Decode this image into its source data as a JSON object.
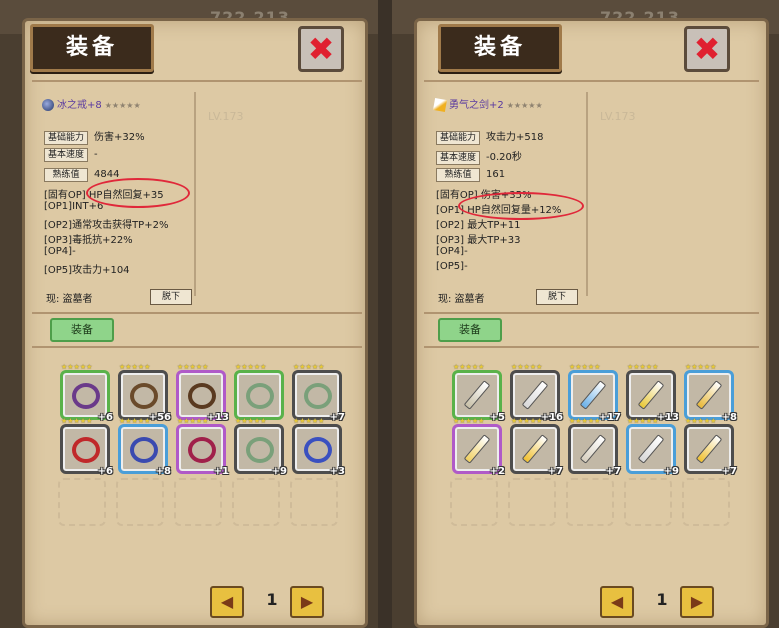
{
  "left": {
    "top_number": "722,213",
    "title": "装备",
    "item_name": "冰之戒+8",
    "stars": "★★★★★",
    "stats": [
      {
        "label": "基础能力",
        "value": "伤害+32%"
      },
      {
        "label": "基本速度",
        "value": "-"
      },
      {
        "label": "熟练值",
        "value": "4844"
      }
    ],
    "options": [
      {
        "prefix": "[固有OP]",
        "text": "HP自然回复+35"
      },
      {
        "prefix": "[OP1]",
        "text": "INT+6"
      },
      {
        "prefix": "[OP2]",
        "text": "通常攻击获得TP+2%"
      },
      {
        "prefix": "[OP3]",
        "text": "毒抵抗+22%"
      },
      {
        "prefix": "[OP4]",
        "text": "-"
      },
      {
        "prefix": "[OP5]",
        "text": "攻击力+104"
      }
    ],
    "current": "现: 盗墓者",
    "unequip": "脱下",
    "equip": "装备",
    "ghost_level": "LV.173",
    "grid": [
      {
        "plus": "+6",
        "frame": "g",
        "color": "#6a3a8a"
      },
      {
        "plus": "+56",
        "frame": "n",
        "color": "#6a4a2a"
      },
      {
        "plus": "+13",
        "frame": "p",
        "color": "#5a3a20"
      },
      {
        "plus": "",
        "frame": "g",
        "color": "#7aa07a"
      },
      {
        "plus": "+7",
        "frame": "n",
        "color": "#7aa07a"
      },
      {
        "plus": "+6",
        "frame": "n",
        "color": "#c0282a"
      },
      {
        "plus": "+8",
        "frame": "b",
        "color": "#3a4ab0"
      },
      {
        "plus": "+1",
        "frame": "p",
        "color": "#a0204a"
      },
      {
        "plus": "+9",
        "frame": "n",
        "color": "#7aa07a"
      },
      {
        "plus": "+3",
        "frame": "n",
        "color": "#3a50c0"
      }
    ],
    "page": "1"
  },
  "right": {
    "top_number": "722,213",
    "title": "装备",
    "item_name": "勇气之剑+2",
    "stars": "★★★★★",
    "stats": [
      {
        "label": "基础能力",
        "value": "攻击力+518"
      },
      {
        "label": "基本速度",
        "value": "-0.20秒"
      },
      {
        "label": "熟练值",
        "value": "161"
      }
    ],
    "options": [
      {
        "prefix": "[固有OP]",
        "text": "伤害+35%"
      },
      {
        "prefix": "[OP1]",
        "text": "HP自然回复量+12%"
      },
      {
        "prefix": "[OP2]",
        "text": "最大TP+11"
      },
      {
        "prefix": "[OP3]",
        "text": "最大TP+33"
      },
      {
        "prefix": "[OP4]",
        "text": "-"
      },
      {
        "prefix": "[OP5]",
        "text": "-"
      }
    ],
    "current": "现: 盗墓者",
    "unequip": "脱下",
    "equip": "装备",
    "ghost_level": "LV.173",
    "grid": [
      {
        "plus": "+5",
        "frame": "g",
        "color": "#c8c0a8"
      },
      {
        "plus": "+16",
        "frame": "n",
        "color": "#d8d8d8"
      },
      {
        "plus": "+17",
        "frame": "b",
        "color": "#6ab0e8"
      },
      {
        "plus": "+13",
        "frame": "n",
        "color": "#e8c838"
      },
      {
        "plus": "+8",
        "frame": "b",
        "color": "#e8b838"
      },
      {
        "plus": "+2",
        "frame": "p",
        "color": "#f0d060"
      },
      {
        "plus": "+7",
        "frame": "n",
        "color": "#f0c030"
      },
      {
        "plus": "+7",
        "frame": "n",
        "color": "#d8d0c0"
      },
      {
        "plus": "+9",
        "frame": "b",
        "color": "#d8d8d8"
      },
      {
        "plus": "+7",
        "frame": "n",
        "color": "#f0c030"
      }
    ],
    "page": "1"
  }
}
